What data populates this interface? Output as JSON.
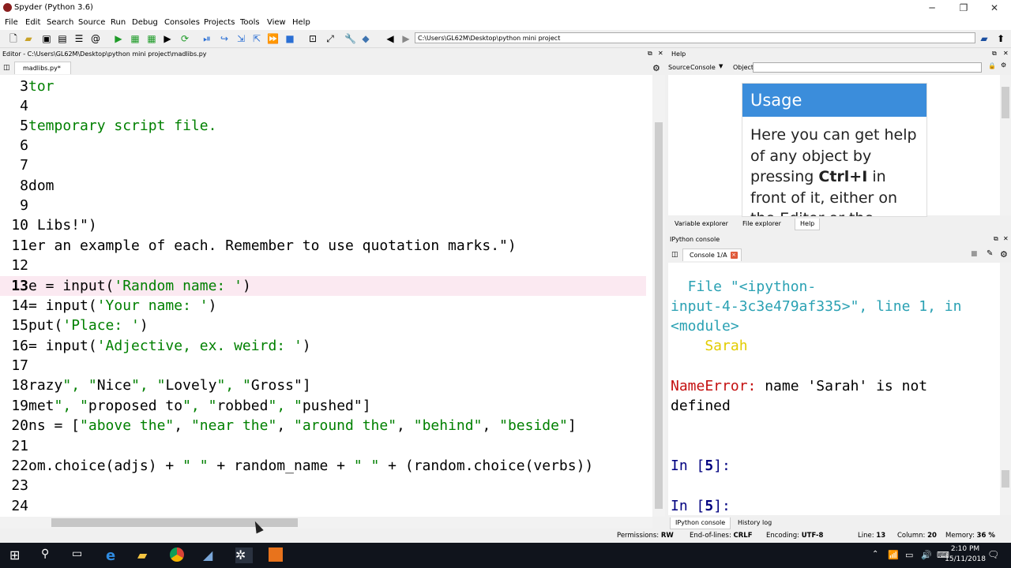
{
  "window": {
    "title": "Spyder (Python 3.6)"
  },
  "menu": [
    "File",
    "Edit",
    "Search",
    "Source",
    "Run",
    "Debug",
    "Consoles",
    "Projects",
    "Tools",
    "View",
    "Help"
  ],
  "toolbar": {
    "path": "C:\\Users\\GL62M\\Desktop\\python mini project"
  },
  "editor": {
    "header": "Editor - C:\\Users\\GL62M\\Desktop\\python mini project\\madlibs.py",
    "tab_label": "madlibs.py*",
    "lines": [
      {
        "num": "3",
        "code": "tor"
      },
      {
        "num": "4",
        "code": ""
      },
      {
        "num": "5",
        "code": "temporary script file."
      },
      {
        "num": "6",
        "code": ""
      },
      {
        "num": "7",
        "code": ""
      },
      {
        "num": "8",
        "code": "dom"
      },
      {
        "num": "9",
        "code": ""
      },
      {
        "num": "10",
        "code": " Libs!\")"
      },
      {
        "num": "11",
        "code": "er an example of each. Remember to use quotation marks.\")"
      },
      {
        "num": "12",
        "code": ""
      },
      {
        "num": "13",
        "code": "e = input('Random name: ')"
      },
      {
        "num": "14",
        "code": "= input('Your name: ')"
      },
      {
        "num": "15",
        "code": "put('Place: ')"
      },
      {
        "num": "16",
        "code": "= input('Adjective, ex. weird: ')"
      },
      {
        "num": "17",
        "code": ""
      },
      {
        "num": "18",
        "code": "razy\", \"Nice\", \"Lovely\", \"Gross\"]"
      },
      {
        "num": "19",
        "code": "met\", \"proposed to\", \"robbed\", \"pushed\"]"
      },
      {
        "num": "20",
        "code": "ns = [\"above the\", \"near the\", \"around the\", \"behind\", \"beside\"]"
      },
      {
        "num": "21",
        "code": ""
      },
      {
        "num": "22",
        "code": "om.choice(adjs) + \" \" + random_name + \" \" + (random.choice(verbs))"
      },
      {
        "num": "23",
        "code": ""
      },
      {
        "num": "24",
        "code": ""
      }
    ]
  },
  "help": {
    "header": "Help",
    "source_label": "Source",
    "source_value": "Console",
    "object_label": "Object",
    "usage_title": "Usage",
    "usage_text_1": "Here you can get help of any object by pressing ",
    "usage_key": "Ctrl+I",
    "usage_text_2": " in front of it, either on the Editor or the",
    "tabs": [
      "Variable explorer",
      "File explorer",
      "Help"
    ]
  },
  "console": {
    "header": "IPython console",
    "tab_label": "Console 1/A",
    "line1": "  File \"<ipython-",
    "line2": "input-4-3c3e479af335>\", line 1, in",
    "line3": "<module>",
    "line4": "    Sarah",
    "error_name": "NameError:",
    "error_msg": " name 'Sarah' is not",
    "error_msg2": "defined",
    "prompt1_pre": "In [",
    "prompt1_num": "5",
    "prompt1_post": "]:",
    "tabs": [
      "IPython console",
      "History log"
    ]
  },
  "status": {
    "permissions_label": "Permissions:",
    "permissions": "RW",
    "eol_label": "End-of-lines:",
    "eol": "CRLF",
    "encoding_label": "Encoding:",
    "encoding": "UTF-8",
    "line_label": "Line:",
    "line": "13",
    "column_label": "Column:",
    "column": "20",
    "memory_label": "Memory:",
    "memory": "36 %"
  },
  "taskbar": {
    "time": "2:10 PM",
    "date": "15/11/2018"
  },
  "colors": {
    "usage_header": "#3b8ddb",
    "string": "#008000",
    "console_cyan": "#2aa1b3",
    "console_yellow": "#e2cc00",
    "error_red": "#c41010"
  }
}
